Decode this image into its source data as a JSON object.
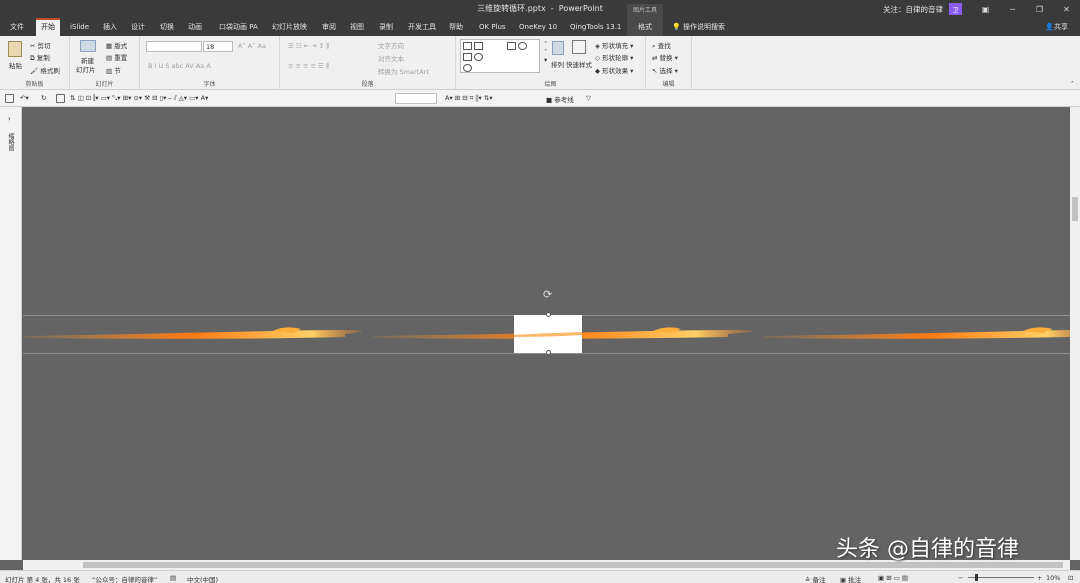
{
  "window": {
    "title": "三维旋转循环.pptx  -  PowerPoint",
    "follow_text": "关注：自律的音律",
    "avatar_text": "卫"
  },
  "tabs": [
    "文件",
    "开始",
    "iSlide",
    "插入",
    "设计",
    "切换",
    "动画",
    "口袋动画 PA",
    "幻灯片放映",
    "审阅",
    "视图",
    "录制",
    "开发工具",
    "帮助",
    "OK Plus",
    "OneKey 10",
    "QingTools 13.1",
    "格式"
  ],
  "active_tab": "开始",
  "context_tab_label": "图片工具",
  "tell_me": "操作说明搜索",
  "share": "共享",
  "ribbon": {
    "clipboard": {
      "paste": "粘贴",
      "cut": "剪切",
      "copy": "复制",
      "painter": "格式刷",
      "label": "剪贴板"
    },
    "slides": {
      "new": "新建",
      "new2": "幻灯片",
      "layout": "版式",
      "reset": "重置",
      "section": "节",
      "label": "幻灯片"
    },
    "font": {
      "size": "18",
      "label": "字体"
    },
    "paragraph": {
      "direction": "文字方向",
      "align": "对齐文本",
      "smartart": "转换为 SmartArt",
      "label": "段落"
    },
    "drawing": {
      "arrange": "排列",
      "quickstyle": "快速样式",
      "fill": "形状填充",
      "outline": "形状轮廓",
      "effect": "形状效果",
      "label": "绘图"
    },
    "editing": {
      "find": "查找",
      "replace": "替换",
      "select": "选择",
      "label": "编辑"
    }
  },
  "qat": {
    "guides": "参考线"
  },
  "left_panel_label": "缩略图",
  "status": {
    "slide_info": "幻灯片 第 4 张，共 16 张",
    "theme": "“公众号：自律的音律”",
    "lang": "中文(中国)",
    "notes": "备注",
    "comments": "批注",
    "zoom": "10%"
  },
  "watermark": "头条 @自律的音律"
}
